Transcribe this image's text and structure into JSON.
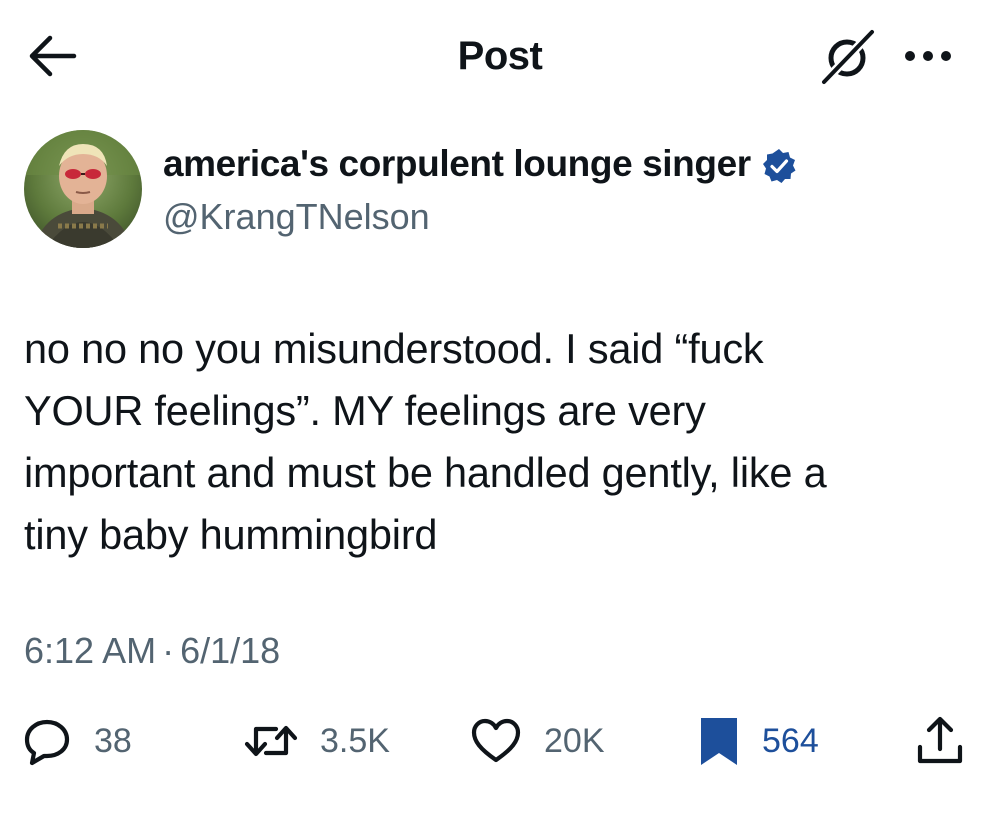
{
  "header": {
    "title": "Post",
    "back_icon": "arrow-left-icon",
    "grok_icon": "grok-icon",
    "more_icon": "more-horizontal-icon"
  },
  "author": {
    "display_name": "america's corpulent lounge singer",
    "handle": "@KrangTNelson",
    "verified": true,
    "verified_color": "#1d4f9b"
  },
  "tweet": {
    "lines": [
      "no no no you misunderstood. I said “fuck",
      "YOUR feelings”. MY feelings are very",
      "important and must be handled gently, like a",
      "tiny baby hummingbird"
    ],
    "time": "6:12 AM",
    "separator": "·",
    "date": "6/1/18"
  },
  "actions": {
    "replies": "38",
    "reposts": "3.5K",
    "likes": "20K",
    "bookmarks": "564",
    "bookmark_color": "#1d4f9b",
    "share_icon": "share-icon"
  }
}
